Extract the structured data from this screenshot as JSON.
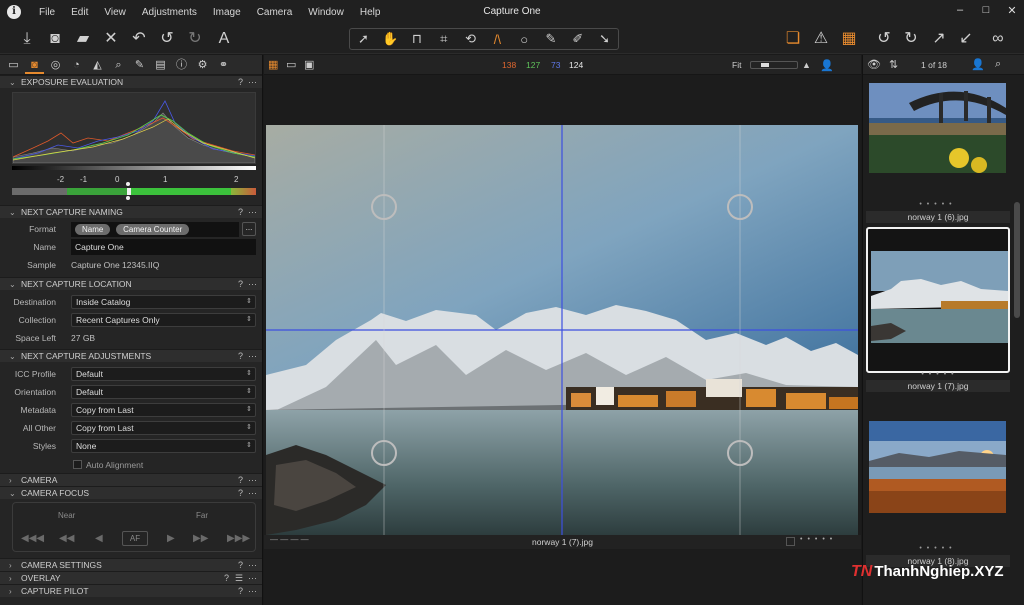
{
  "app": {
    "title": "Capture One",
    "menu": [
      "File",
      "Edit",
      "View",
      "Adjustments",
      "Image",
      "Camera",
      "Window",
      "Help"
    ],
    "window_controls": [
      "–",
      "□",
      "✕"
    ]
  },
  "colors": {
    "accent": "#e68a2e",
    "guide_blue": "#3d4fe0"
  },
  "histogram": {
    "ticks": [
      "-2",
      "-1",
      "0",
      "1",
      "2"
    ]
  },
  "sections": {
    "exposure": "EXPOSURE EVALUATION",
    "naming": "NEXT CAPTURE NAMING",
    "location": "NEXT CAPTURE LOCATION",
    "adjustments": "NEXT CAPTURE ADJUSTMENTS",
    "camera": "CAMERA",
    "camera_focus": "CAMERA FOCUS",
    "camera_settings": "CAMERA SETTINGS",
    "overlay": "OVERLAY",
    "capture_pilot": "CAPTURE PILOT"
  },
  "naming": {
    "format_label": "Format",
    "format_tokens": [
      "Name",
      "Camera Counter"
    ],
    "name_label": "Name",
    "name_value": "Capture One",
    "sample_label": "Sample",
    "sample_value": "Capture One 12345.IIQ"
  },
  "location": {
    "destination_label": "Destination",
    "destination_value": "Inside Catalog",
    "collection_label": "Collection",
    "collection_value": "Recent Captures Only",
    "space_label": "Space Left",
    "space_value": "27 GB"
  },
  "adjustments": {
    "icc_label": "ICC Profile",
    "icc_value": "Default",
    "orientation_label": "Orientation",
    "orientation_value": "Default",
    "metadata_label": "Metadata",
    "metadata_value": "Copy from Last",
    "allother_label": "All Other",
    "allother_value": "Copy from Last",
    "styles_label": "Styles",
    "styles_value": "None",
    "auto_alignment": "Auto Alignment"
  },
  "focus": {
    "near": "Near",
    "far": "Far",
    "af": "AF"
  },
  "viewer": {
    "rgb": {
      "r": "138",
      "g": "127",
      "b": "73",
      "l": "124"
    },
    "zoom": "Fit",
    "filename": "norway 1 (7).jpg"
  },
  "browser": {
    "counter": "1 of 18",
    "thumbs": [
      {
        "name": "norway 1 (6).jpg"
      },
      {
        "name": "norway 1 (7).jpg"
      },
      {
        "name": "norway 1 (8).jpg"
      }
    ]
  },
  "watermark": {
    "logo": "TN",
    "text": "ThanhNghiep.XYZ"
  }
}
